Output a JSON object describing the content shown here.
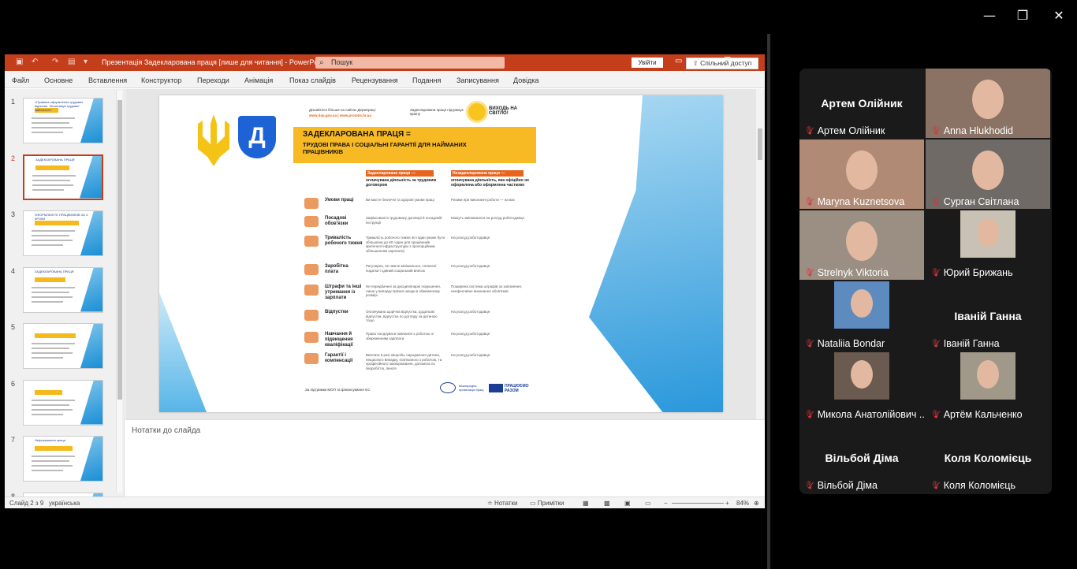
{
  "window_controls": {
    "minimize": "—",
    "restore": "❐",
    "close": "✕"
  },
  "ppt": {
    "title": "Презентація Задекларована праця [лише для читання] - PowerPoint",
    "search_placeholder": "Пошук",
    "signin": "Увійти",
    "tabs": [
      "Файл",
      "Основне",
      "Вставлення",
      "Конструктор",
      "Переходи",
      "Анімація",
      "Показ слайдів",
      "Рецензування",
      "Подання",
      "Записування",
      "Довідка"
    ],
    "share": "Спільний доступ",
    "thumbnails": [
      {
        "num": "1",
        "text": "«Правила оформлення трудових відносин. Легалізація трудової зайнятості»"
      },
      {
        "num": "2",
        "text": "ЗАДЕКЛАРОВАНА ПРАЦЯ"
      },
      {
        "num": "3",
        "text": "ОФОРМЛЮЄТЕ ПРАЦІВНИКІВ ЗА 3 КРОКИ"
      },
      {
        "num": "4",
        "text": "ЗАДЕКЛАРОВАНА ПРАЦЯ"
      },
      {
        "num": "5",
        "text": ""
      },
      {
        "num": "6",
        "text": ""
      },
      {
        "num": "7",
        "text": "Неформальна праця"
      },
      {
        "num": "8",
        "text": ""
      }
    ],
    "notes_placeholder": "Нотатки до слайда",
    "status": {
      "slide": "Слайд 2 з 9",
      "lang": "українська",
      "notes": "Нотатки",
      "comments": "Примітки",
      "zoom": "84%"
    }
  },
  "slide": {
    "header_left": "Дізнайтеся більше на сайтах Держпраці:",
    "header_links": "www.dsp.gov.ua  |  www.protatis.hr.ua",
    "header_mid": "Задекларована праця підтримує країну",
    "header_right": "ВИХОДЬ НА СВІТЛО!",
    "title_1": "ЗАДЕКЛАРОВАНА ПРАЦЯ =",
    "title_2": "ТРУДОВІ ПРАВА І СОЦІАЛЬНІ ГАРАНТІЇ ДЛЯ НАЙМАНИХ ПРАЦІВНИКІВ",
    "col_left_head": "Задекларована праця —",
    "col_left_sub": "оплачувана діяльність за трудовим договором",
    "col_right_head": "Незадекларована праця —",
    "col_right_sub": "оплачувана діяльність, яка офіційно не оформлена або оформлена частково",
    "rows": [
      {
        "label": "Умови праці",
        "left": "Ви маєте безпечні та здорові умови праці",
        "right": "Ризики при виконанні роботи — на вас"
      },
      {
        "label": "Посадові обов'язки",
        "left": "Зафіксовані в трудовому договорі й посадовій інструкції",
        "right": "Можуть змінюватися на розсуд роботодавця"
      },
      {
        "label": "Тривалість робочого тижня",
        "left": "Тривалість робочого тижня 40 годин (може бути збільшена до 60 годин для працівників критичної інфраструктури з пропорційним збільшенням зарплати)",
        "right": "На розсуд роботодавця"
      },
      {
        "label": "Заробітна плата",
        "left": "Регулярна, не нижче мінімальної, сплачені податки і єдиний соціальний внесок",
        "right": "На розсуд роботодавця"
      },
      {
        "label": "Штрафи та інші утримання із зарплати",
        "left": "Не передбачені за дисциплінарні порушення, лише у випадку прямої шкоди в обмеженому розмірі",
        "right": "Поширена система штрафів за запізнення, неефективне виконання обов'язків"
      },
      {
        "label": "Відпустки",
        "left": "Оплачувана щорічна відпустка, додаткові відпустки, відпустка по догляду за дитиною тощо",
        "right": "На розсуд роботодавця"
      },
      {
        "label": "Навчання й підвищення кваліфікації",
        "left": "Право поєднувати навчання з роботою зі збереженням зарплати",
        "right": "На розсуд роботодавця"
      },
      {
        "label": "Гарантії і компенсації",
        "left": "Виплати в разі хвороби, народження дитини, нещасного випадку, пов'язаного з роботою, та професійного захворювання, допомога по безробіттю, пенсія",
        "right": "На розсуд роботодавця"
      }
    ],
    "footer_left": "За підтримки МОП та фінансування ЄС",
    "footer_ilo": "Міжнародна організація праці",
    "footer_eu": "ПРАЦЮЄМО РАЗОМ"
  },
  "participants": [
    {
      "name": "Артем Олійник",
      "big": "Артем Олійник",
      "photo": false
    },
    {
      "name": "Anna Hlukhodid",
      "big": "",
      "photo": true
    },
    {
      "name": "Maryna Kuznetsova",
      "big": "",
      "photo": true
    },
    {
      "name": "Сурган Світлана",
      "big": "",
      "photo": true,
      "active": true
    },
    {
      "name": "Strelnyk Viktoria",
      "big": "",
      "photo": true
    },
    {
      "name": "Юрий Брижань",
      "big": "",
      "photo": true
    },
    {
      "name": "Nataliia Bondar",
      "big": "",
      "photo": true
    },
    {
      "name": "Іваній Ганна",
      "big": "Іваній Ганна",
      "photo": false
    },
    {
      "name": "Микола Анатолійович ...",
      "big": "",
      "photo": true
    },
    {
      "name": "Артём Кальченко",
      "big": "",
      "photo": true
    },
    {
      "name": "Вільбой Діма",
      "big": "Вільбой Діма",
      "photo": false
    },
    {
      "name": "Коля Коломієць",
      "big": "Коля Коломієць",
      "photo": false
    }
  ]
}
